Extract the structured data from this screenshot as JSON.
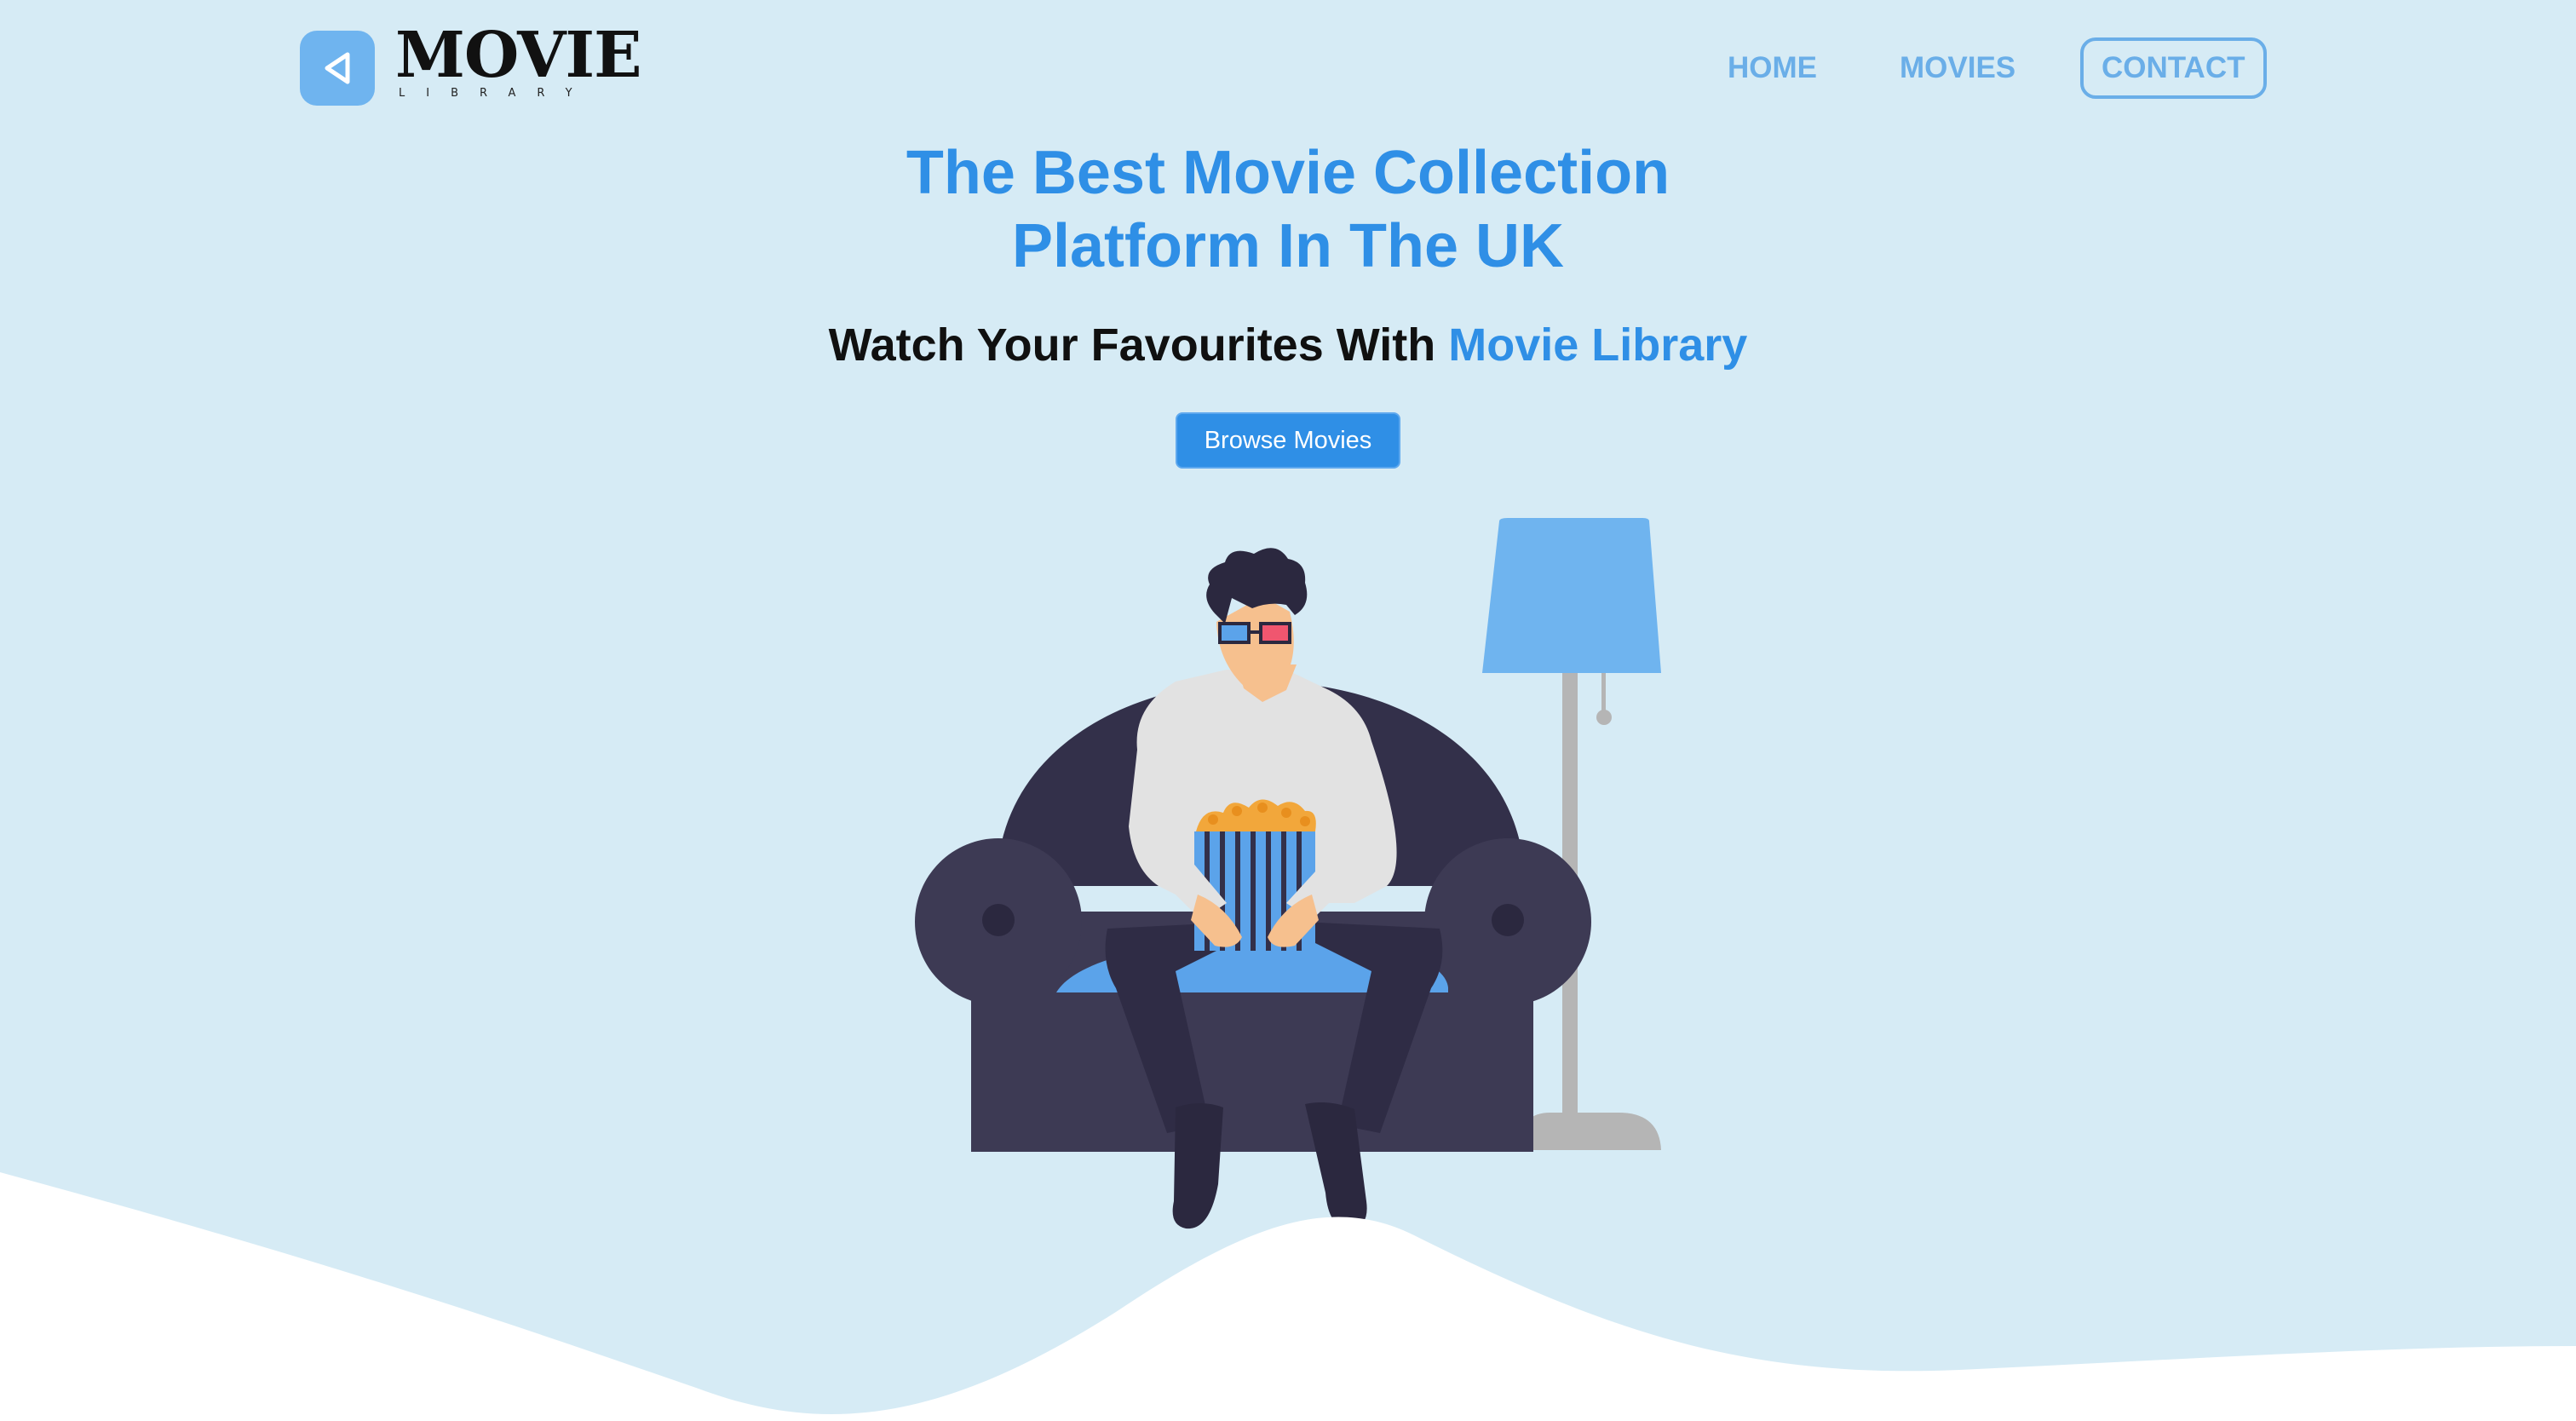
{
  "brand": {
    "name": "MOVIE",
    "tagline": "LIBRARY",
    "logo_icon": "play-back-triangle-icon",
    "badge_color": "#6fb4ef"
  },
  "nav": {
    "items": [
      {
        "label": "HOME"
      },
      {
        "label": "MOVIES"
      },
      {
        "label": "CONTACT"
      }
    ],
    "color": "#6aaee8"
  },
  "hero": {
    "title_line1": "The Best Movie Collection",
    "title_line2": "Platform In The UK",
    "subtitle_prefix": "Watch Your Favourites With",
    "subtitle_brand": "Movie Library",
    "cta_label": "Browse Movies",
    "accent": "#2f8fe6"
  },
  "colors": {
    "background": "#d6ebf5",
    "armchair": "#3d3a54",
    "lamp_shade": "#6fb4ef",
    "lamp_stand": "#b5b5b5"
  }
}
